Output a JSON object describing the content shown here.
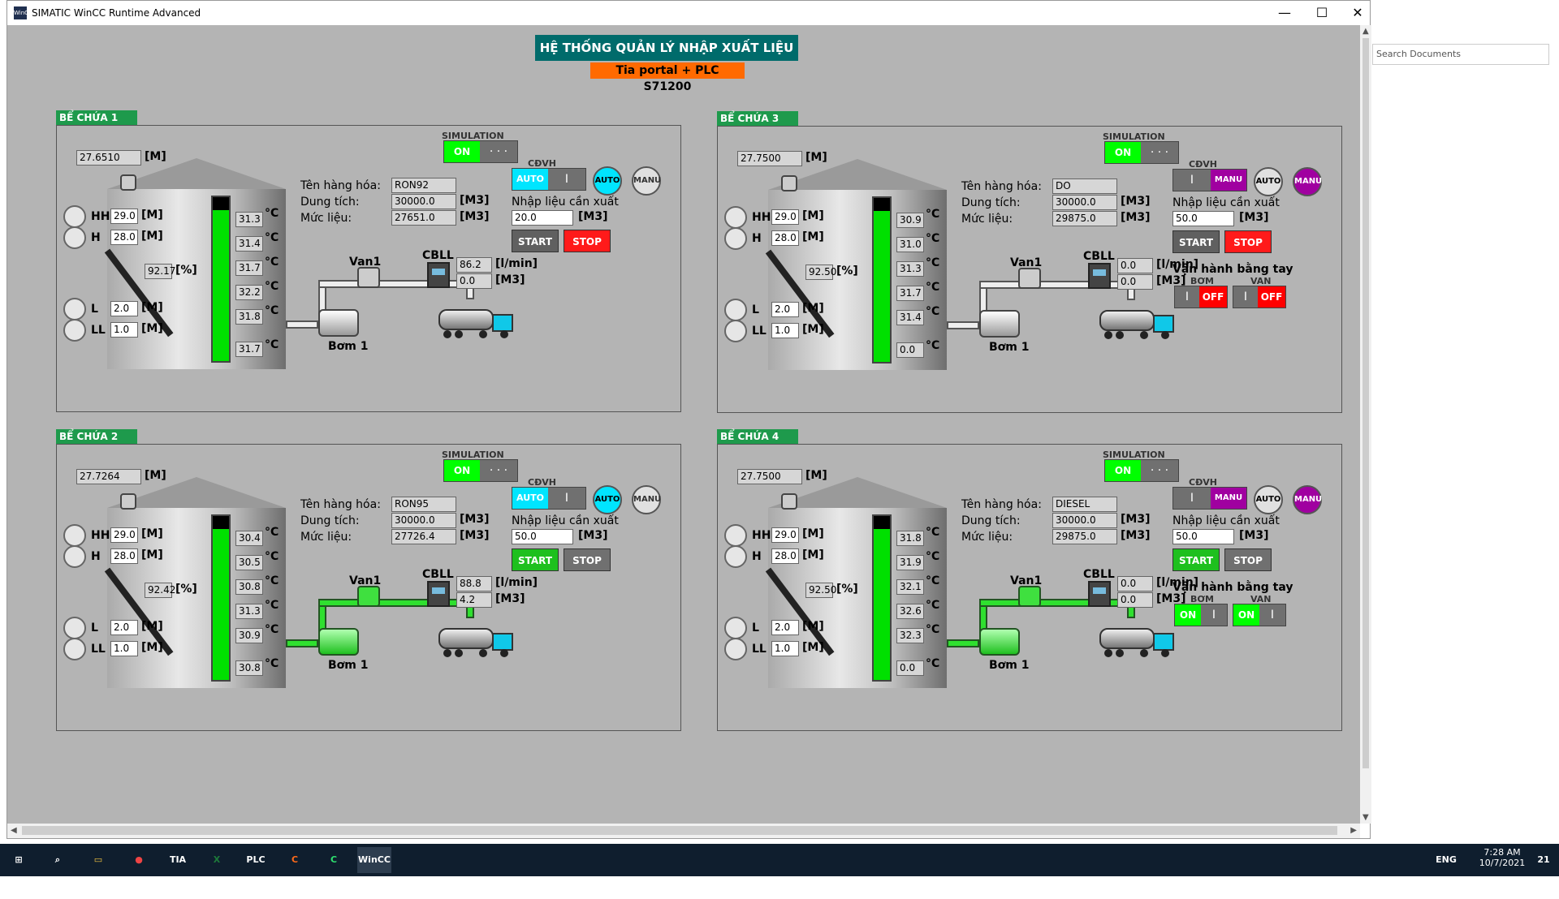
{
  "window": {
    "title": "SIMATIC WinCC Runtime Advanced",
    "icon": "winCC",
    "min": "—",
    "max": "☐",
    "close": "✕"
  },
  "header": {
    "title": "HỆ THỐNG QUẢN LÝ NHẬP XUẤT LIỆU",
    "subtitle": "Tia portal + PLC S71200"
  },
  "common": {
    "m": "[M]",
    "pct": "[%]",
    "m3": "[M3]",
    "lpm": "[l/min]",
    "degc": "°C",
    "hh": "HH",
    "h": "H",
    "l": "L",
    "ll": "LL",
    "van1": "Van1",
    "cbll": "CBLL",
    "bom1": "Bơm 1",
    "simulation": "SIMULATION",
    "cdvh": "CĐVH",
    "ten": "Tên hàng hóa:",
    "dung": "Dung tích:",
    "muc": "Mức liệu:",
    "nhap": "Nhập liệu cần xuất",
    "start": "START",
    "stop": "STOP",
    "on": "ON",
    "off": "OFF",
    "auto": "AUTO",
    "manu": "MANU",
    "dots": "· · ·",
    "bar": "I",
    "vanhanh": "Vận hành bằng tay",
    "bom": "BƠM",
    "van": "VAN"
  },
  "tanks": [
    {
      "tab": "BỂ CHỨA 1",
      "level_m": "27.6510",
      "hh": "29.0",
      "h": "28.0",
      "l": "2.0",
      "ll": "1.0",
      "pct": "92.17",
      "pct_fill": 92,
      "temps": [
        "31.3",
        "31.4",
        "31.7",
        "32.2",
        "31.8"
      ],
      "temp_bottom": "31.7",
      "name": "RON92",
      "capacity": "30000.0",
      "level_m3": "27651.0",
      "flow": "86.2",
      "vol": "0.0",
      "setpoint": "20.0",
      "mode": "auto",
      "pipe_active": false
    },
    {
      "tab": "BỂ CHỨA 2",
      "level_m": "27.7264",
      "hh": "29.0",
      "h": "28.0",
      "l": "2.0",
      "ll": "1.0",
      "pct": "92.42",
      "pct_fill": 92,
      "temps": [
        "30.4",
        "30.5",
        "30.8",
        "31.3",
        "30.9"
      ],
      "temp_bottom": "30.8",
      "name": "RON95",
      "capacity": "30000.0",
      "level_m3": "27726.4",
      "flow": "88.8",
      "vol": "4.2",
      "setpoint": "50.0",
      "mode": "auto",
      "pipe_active": true
    },
    {
      "tab": "BỂ CHỨA 3",
      "level_m": "27.7500",
      "hh": "29.0",
      "h": "28.0",
      "l": "2.0",
      "ll": "1.0",
      "pct": "92.50",
      "pct_fill": 92,
      "temps": [
        "30.9",
        "31.0",
        "31.3",
        "31.7",
        "31.4"
      ],
      "temp_bottom": "0.0",
      "name": "DO",
      "capacity": "30000.0",
      "level_m3": "29875.0",
      "flow": "0.0",
      "vol": "0.0",
      "setpoint": "50.0",
      "mode": "manu",
      "pipe_active": false,
      "manual_bom": "OFF",
      "manual_van": "OFF"
    },
    {
      "tab": "BỂ CHỨA 4",
      "level_m": "27.7500",
      "hh": "29.0",
      "h": "28.0",
      "l": "2.0",
      "ll": "1.0",
      "pct": "92.50",
      "pct_fill": 92,
      "temps": [
        "31.8",
        "31.9",
        "32.1",
        "32.6",
        "32.3"
      ],
      "temp_bottom": "0.0",
      "name": "DIESEL",
      "capacity": "30000.0",
      "level_m3": "29875.0",
      "flow": "0.0",
      "vol": "0.0",
      "setpoint": "50.0",
      "mode": "manu",
      "pipe_active": true,
      "manual_bom": "ON",
      "manual_van": "ON"
    }
  ],
  "sidepane": {
    "search": "Search Documents"
  },
  "taskbar": {
    "apps": [
      "TIA",
      "X",
      "PLC SIM",
      "C",
      "C",
      "WinCC RA"
    ],
    "lang": "ENG",
    "time": "7:28 AM",
    "date": "10/7/2021",
    "notif": "21"
  }
}
